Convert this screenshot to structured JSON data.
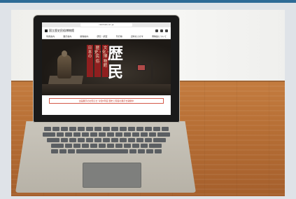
{
  "browser": {
    "url": "rekihaku.ac.jp"
  },
  "site": {
    "logo_text": "国立歴史民俗博物館",
    "nav_items": [
      "利用案内",
      "展示案内",
      "催物案内",
      "研究・調査",
      "刊行物",
      "資料をさがす",
      "博物館について"
    ]
  },
  "hero": {
    "banners": [
      "日本の",
      "歴史・民俗",
      "文化・博物館"
    ],
    "big_kanji": [
      "歴",
      "民"
    ]
  },
  "notice": {
    "text": "企画展示のお知らせ 令和5年度 歴史と民俗の展示を開催中"
  },
  "colors": {
    "accent_red": "#8f1f1f",
    "notice_red": "#c23a2a",
    "table_wood": "#b76f35",
    "header_bar": "#2e6b96"
  }
}
